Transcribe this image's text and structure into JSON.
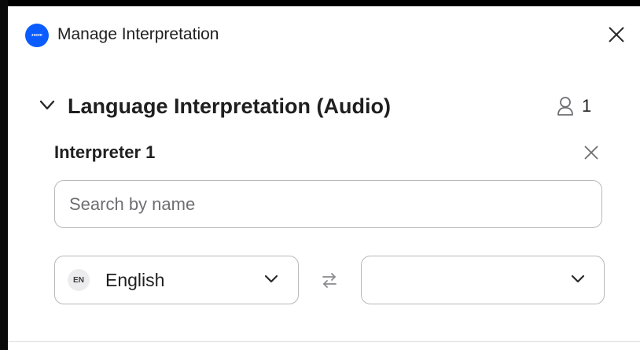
{
  "window": {
    "title": "Manage Interpretation",
    "app_icon": "zoom-logo-icon",
    "app_icon_text": "zoom",
    "close_icon": "close-icon",
    "accent_color": "#0b5cff"
  },
  "section": {
    "title": "Language Interpretation (Audio)",
    "collapse_icon": "chevron-down-icon",
    "participant_icon": "person-icon",
    "participant_count": "1"
  },
  "interpreter": {
    "label": "Interpreter 1",
    "remove_icon": "close-icon",
    "search": {
      "placeholder": "Search by name",
      "value": ""
    },
    "from_language": {
      "code": "EN",
      "name": "English"
    },
    "swap_icon": "swap-arrows-icon",
    "to_language": {
      "code": "",
      "name": ""
    }
  }
}
